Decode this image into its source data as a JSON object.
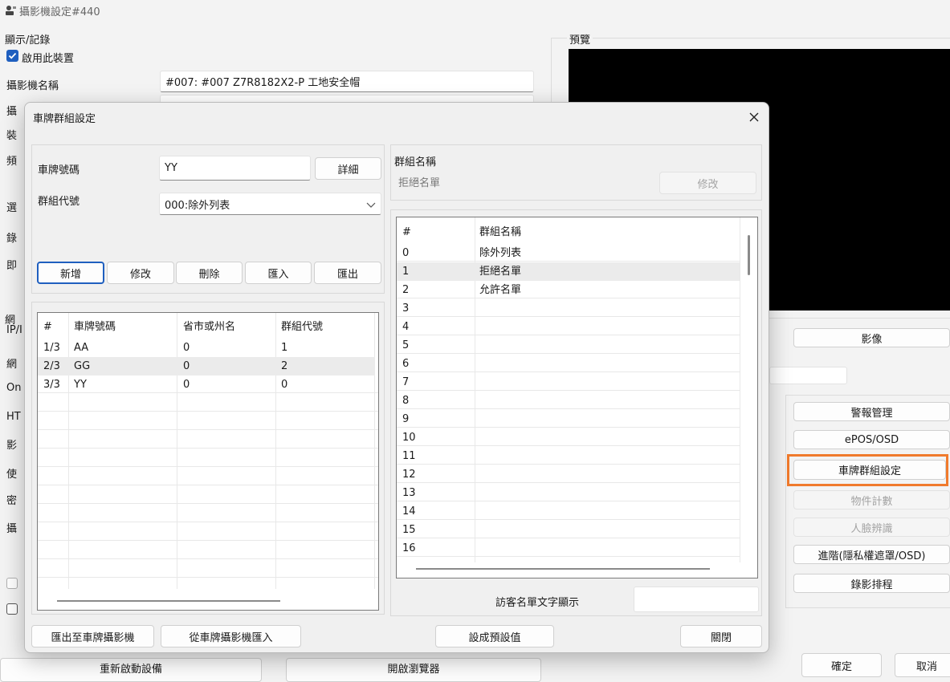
{
  "window": {
    "title": "攝影機設定#440"
  },
  "display_group": {
    "title": "顯示/記錄",
    "enable_label": "啟用此裝置",
    "enabled": true
  },
  "camera_name": {
    "label": "攝影機名稱",
    "value": "#007: #007 Z7R8182X2-P 工地安全帽"
  },
  "preview": {
    "title": "預覽"
  },
  "bg_cut": {
    "l1": "攝",
    "l2": "裝",
    "l3": "頻",
    "l4": "選",
    "l5": "錄",
    "l6": "即",
    "net_title": "網",
    "n1": "IP/I",
    "n2": "網",
    "n3": "On",
    "n4": "HT",
    "n5": "影",
    "n6": "使",
    "n7": "密",
    "n8": "攝"
  },
  "right_buttons": {
    "video": "影像",
    "alarm": "警報管理",
    "epos": "ePOS/OSD",
    "plate_group": "車牌群組設定",
    "object_count": "物件計數",
    "face": "人臉辨識",
    "advanced": "進階(隱私權遮罩/OSD)",
    "record_schedule": "錄影排程"
  },
  "bottom": {
    "restart": "重新啟動設備",
    "browser": "開啟瀏覽器",
    "ok": "確定",
    "cancel": "取消"
  },
  "dialog": {
    "title": "車牌群組設定",
    "plate_label": "車牌號碼",
    "plate_value": "YY",
    "detail_btn": "詳細",
    "group_code_label": "群組代號",
    "group_code_value": "000:除外列表",
    "buttons": {
      "add": "新增",
      "modify": "修改",
      "delete": "刪除",
      "import": "匯入",
      "export": "匯出"
    },
    "plate_table": {
      "headers": [
        "#",
        "車牌號碼",
        "省市或州名",
        "群組代號"
      ],
      "rows": [
        [
          "1/3",
          "AA",
          "0",
          "1"
        ],
        [
          "2/3",
          "GG",
          "0",
          "2"
        ],
        [
          "3/3",
          "YY",
          "0",
          "0"
        ]
      ]
    },
    "group_name_label": "群組名稱",
    "group_name_value": "拒絕名單",
    "group_modify_btn": "修改",
    "group_table": {
      "headers": [
        "#",
        "群組名稱"
      ],
      "rows": [
        [
          "0",
          "除外列表"
        ],
        [
          "1",
          "拒絕名單"
        ],
        [
          "2",
          "允許名單"
        ],
        [
          "3",
          ""
        ],
        [
          "4",
          ""
        ],
        [
          "5",
          ""
        ],
        [
          "6",
          ""
        ],
        [
          "7",
          ""
        ],
        [
          "8",
          ""
        ],
        [
          "9",
          ""
        ],
        [
          "10",
          ""
        ],
        [
          "11",
          ""
        ],
        [
          "12",
          ""
        ],
        [
          "13",
          ""
        ],
        [
          "14",
          ""
        ],
        [
          "15",
          ""
        ],
        [
          "16",
          ""
        ]
      ]
    },
    "visitor_label": "訪客名單文字顯示",
    "visitor_value": "",
    "export_to_camera": "匯出至車牌攝影機",
    "import_from_camera": "從車牌攝影機匯入",
    "set_default": "設成預設值",
    "close": "關閉"
  },
  "colors": {
    "highlight": "#f07a2c",
    "check": "#1f5fbf"
  }
}
